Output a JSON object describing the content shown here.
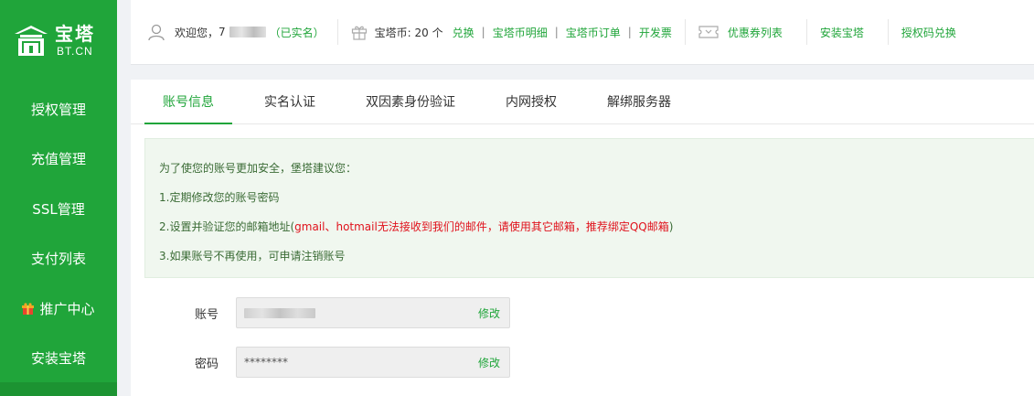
{
  "brand": {
    "title": "宝塔",
    "subtitle": "BT.CN"
  },
  "sidebar": {
    "items": [
      {
        "label": "授权管理"
      },
      {
        "label": "充值管理"
      },
      {
        "label": "SSL管理"
      },
      {
        "label": "支付列表"
      },
      {
        "label": "推广中心"
      },
      {
        "label": "安装宝塔"
      }
    ]
  },
  "topbar": {
    "welcome": "欢迎您，",
    "user_initial": "7",
    "verified": "（已实名）",
    "coin_label": "宝塔币: 20 个",
    "exchange": "兑换",
    "coin_detail": "宝塔币明细",
    "coin_orders": "宝塔币订单",
    "invoice": "开发票",
    "pipe": "|",
    "coupons": "优惠券列表",
    "install": "安装宝塔",
    "auth_code": "授权码兑换"
  },
  "tabs": [
    {
      "label": "账号信息",
      "active": true
    },
    {
      "label": "实名认证",
      "active": false
    },
    {
      "label": "双因素身份验证",
      "active": false
    },
    {
      "label": "内网授权",
      "active": false
    },
    {
      "label": "解绑服务器",
      "active": false
    }
  ],
  "notice": {
    "intro": "为了使您的账号更加安全，堡塔建议您：",
    "line1": "1.定期修改您的账号密码",
    "line2_a": "2.设置并验证您的邮箱地址(",
    "line2_b": "gmail、hotmail无法接收到我们的邮件，请使用其它邮箱，推荐绑定QQ邮箱",
    "line2_c": ")",
    "line3": "3.如果账号不再使用，可申请注销账号"
  },
  "form": {
    "account_label": "账号",
    "password_label": "密码",
    "password_value": "********",
    "edit": "修改"
  },
  "colors": {
    "brand_green": "#20a53a",
    "warn_red": "#e0121c",
    "notice_bg": "#f0f7ef"
  }
}
